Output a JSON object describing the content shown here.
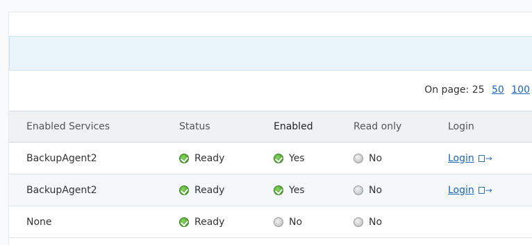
{
  "pager": {
    "label": "On page:",
    "current": "25",
    "options": [
      "50",
      "100"
    ]
  },
  "table": {
    "columns": [
      "Enabled Services",
      "Status",
      "Enabled",
      "Read only",
      "Login"
    ],
    "rows": [
      {
        "service": "BackupAgent2",
        "status": "Ready",
        "status_icon": "check-circle-icon",
        "enabled": "Yes",
        "enabled_icon": "check-circle-icon",
        "read_only": "No",
        "read_only_icon": "grey-circle-icon",
        "login": "Login",
        "login_icon": "login-arrow-icon"
      },
      {
        "service": "BackupAgent2",
        "status": "Ready",
        "status_icon": "check-circle-icon",
        "enabled": "Yes",
        "enabled_icon": "check-circle-icon",
        "read_only": "No",
        "read_only_icon": "grey-circle-icon",
        "login": "Login",
        "login_icon": "login-arrow-icon"
      },
      {
        "service": "None",
        "status": "Ready",
        "status_icon": "check-circle-icon",
        "enabled": "No",
        "enabled_icon": "grey-circle-icon",
        "read_only": "No",
        "read_only_icon": "grey-circle-icon",
        "login": "",
        "login_icon": ""
      }
    ]
  },
  "colors": {
    "link": "#1a64b8",
    "ok_green": "#4fa82e",
    "header_bg": "#eef2f5",
    "info_bar_bg": "#eaf4fb"
  }
}
